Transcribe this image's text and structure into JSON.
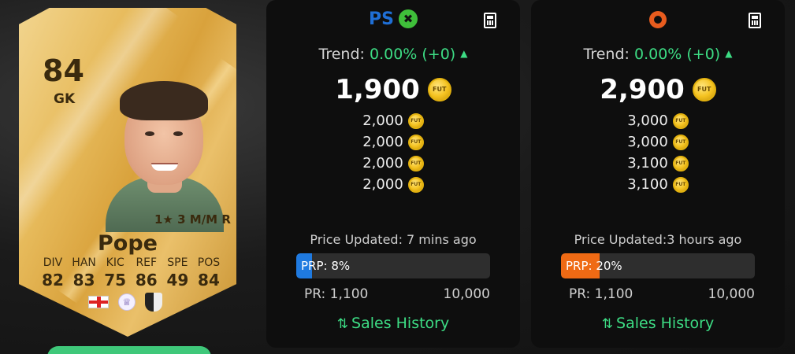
{
  "card": {
    "rating": "84",
    "position": "GK",
    "name": "Pope",
    "stars_line": "1★ 3 M/M R",
    "stat_labels": [
      "DIV",
      "HAN",
      "KIC",
      "REF",
      "SPE",
      "POS"
    ],
    "stat_values": [
      "82",
      "83",
      "75",
      "86",
      "49",
      "84"
    ],
    "nation_icon": "england-flag-icon",
    "league_icon": "premier-league-icon",
    "club_icon": "newcastle-crest-icon",
    "card_color": "#e2b24f"
  },
  "panels": [
    {
      "platforms": [
        "playstation-icon",
        "xbox-icon"
      ],
      "trend_label": "Trend:",
      "trend_value": "0.00% (+0)",
      "main_price": "1,900",
      "prices": [
        "2,000",
        "2,000",
        "2,000",
        "2,000"
      ],
      "updated": "Price Updated: 7 mins ago",
      "prp_text": "PRP: 8%",
      "prp_percent": 8,
      "prp_color": "#1f7ae0",
      "pr_min": "PR: 1,100",
      "pr_max": "10,000",
      "sales_history": "Sales History"
    },
    {
      "platforms": [
        "origin-icon"
      ],
      "trend_label": "Trend:",
      "trend_value": "0.00% (+0)",
      "main_price": "2,900",
      "prices": [
        "3,000",
        "3,000",
        "3,100",
        "3,100"
      ],
      "updated": "Price Updated:3 hours ago",
      "prp_text": "PRP: 20%",
      "prp_percent": 20,
      "prp_color": "#ef6a14",
      "pr_min": "PR: 1,100",
      "pr_max": "10,000",
      "sales_history": "Sales History"
    }
  ],
  "coin_label": "FUT",
  "accent_green": "#3ddc84"
}
